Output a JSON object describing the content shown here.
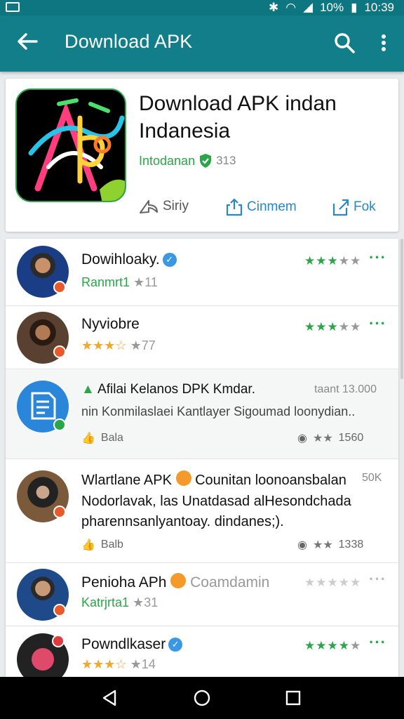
{
  "status_bar": {
    "battery": "10%",
    "time": "10:39"
  },
  "app_bar": {
    "title": "Download APK",
    "back_icon": "arrow-left-icon",
    "search_icon": "search-icon",
    "more_icon": "more-vertical-icon"
  },
  "app_card": {
    "title": "Download APK indan Indanesia",
    "publisher": "Intodanan",
    "rating": "313",
    "actions": {
      "share": "Siriy",
      "comment": "Cinmem",
      "fork": "Fok"
    }
  },
  "reviews": [
    {
      "name": "Dowihloaky.",
      "sub_label": "Ranmrt1",
      "sub_count": "11",
      "verified": true,
      "stars": "3.5"
    },
    {
      "name": "Nyviobre",
      "sub_count": "77",
      "stars": "3.5"
    },
    {
      "title": "Afilai Kelanos DPK Kmdar.",
      "time": "taant 13.000",
      "text": "nin Konmilaslaei Kantlayer Sigoumad loonydian..",
      "label": "Bala",
      "count": "1560"
    },
    {
      "title": "Wlartlane APK",
      "title_rest": "Counitan loonoansbalan",
      "time": "50K",
      "text": "Nodorlavak, las Unatdasad alHesondchada pharennsanlyantoay. dindanes;).",
      "label": "Balb",
      "count": "1338"
    },
    {
      "name": "Penioha APh",
      "name_rest": "Coamdamin",
      "sub_label": "Katrjrta1",
      "sub_count": "31",
      "stars": "0"
    },
    {
      "name": "Powndlkaser",
      "sub_count": "14",
      "verified": true,
      "stars": "4"
    }
  ],
  "colors": {
    "app_bar": "#127e89",
    "status_bar": "#0e7680",
    "accent_green": "#2aa548",
    "link_blue": "#2a86c8",
    "star_gold": "#f0a92c"
  }
}
